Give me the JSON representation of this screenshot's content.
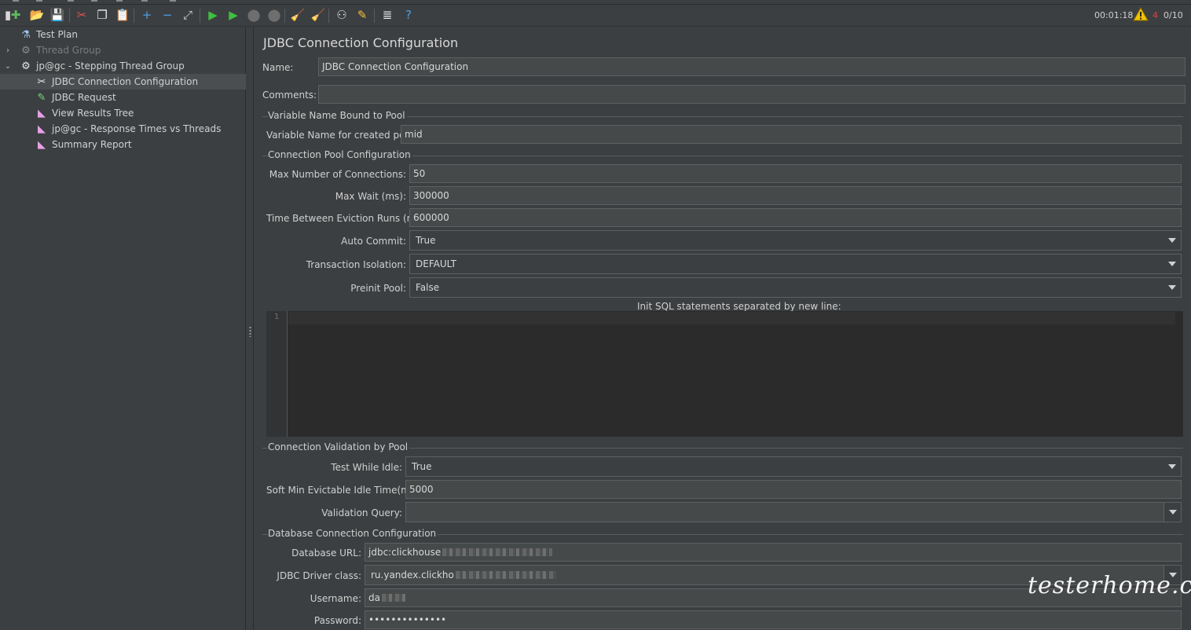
{
  "toolbar": {
    "buttons": [
      {
        "name": "templates-button",
        "glyph": "▮",
        "color": "#d8d8d8"
      },
      {
        "name": "new-button",
        "glyph": "✚",
        "color": "#5fb760"
      },
      {
        "name": "open-button",
        "glyph": "📂",
        "color": "#e2b04a"
      },
      {
        "name": "save-button",
        "glyph": "💾",
        "color": "#c9c9c9"
      },
      {
        "name": "cut-button",
        "glyph": "✂",
        "color": "#d9534f"
      },
      {
        "name": "copy-button",
        "glyph": "❐",
        "color": "#e8e8e8"
      },
      {
        "name": "paste-button",
        "glyph": "📋",
        "color": "#e8e8e8"
      },
      {
        "name": "expand-button",
        "glyph": "+",
        "color": "#4a9fe8"
      },
      {
        "name": "collapse-button",
        "glyph": "−",
        "color": "#4a9fe8"
      },
      {
        "name": "toggle-button",
        "glyph": "⤢",
        "color": "#cfcfcf"
      },
      {
        "name": "start-button",
        "glyph": "▶",
        "color": "#3fbf3f"
      },
      {
        "name": "start-no-pauses-button",
        "glyph": "▶",
        "color": "#3fbf3f"
      },
      {
        "name": "stop-button",
        "glyph": "⬤",
        "color": "#6e6e6e"
      },
      {
        "name": "shutdown-button",
        "glyph": "⬤",
        "color": "#6e6e6e"
      },
      {
        "name": "clear-button",
        "glyph": "🧹",
        "color": "#d9b24a"
      },
      {
        "name": "clear-all-button",
        "glyph": "🧹",
        "color": "#d9b24a"
      },
      {
        "name": "search-button",
        "glyph": "⚇",
        "color": "#d8d8d8"
      },
      {
        "name": "reset-search-button",
        "glyph": "✎",
        "color": "#f0c040"
      },
      {
        "name": "function-helper-button",
        "glyph": "≣",
        "color": "#e8e8e8"
      },
      {
        "name": "help-button",
        "glyph": "?",
        "color": "#4a9fe8"
      }
    ],
    "elapsed": "00:01:18",
    "warning_icon": "warning-icon",
    "error_count": "4",
    "threads": "0/10"
  },
  "tree": {
    "items": [
      {
        "label": "Test Plan",
        "icon": "flask-icon",
        "glyph": "⚗",
        "icon_color": "#9fc4ef",
        "arrow": "",
        "depth": 0,
        "disabled": false,
        "selected": false
      },
      {
        "label": "Thread Group",
        "icon": "gear-icon",
        "glyph": "⚙",
        "icon_color": "#8a8a8a",
        "arrow": "›",
        "depth": 0,
        "disabled": true,
        "selected": false
      },
      {
        "label": "jp@gc - Stepping Thread Group",
        "icon": "gear-icon",
        "glyph": "⚙",
        "icon_color": "#e6e6e6",
        "arrow": "⌄",
        "depth": 0,
        "disabled": false,
        "selected": false
      },
      {
        "label": "JDBC Connection Configuration",
        "icon": "wrench-icon",
        "glyph": "✂",
        "icon_color": "#e6e6e6",
        "arrow": "",
        "depth": 1,
        "disabled": false,
        "selected": true
      },
      {
        "label": "JDBC Request",
        "icon": "pipette-icon",
        "glyph": "✎",
        "icon_color": "#7cd67c",
        "arrow": "",
        "depth": 1,
        "disabled": false,
        "selected": false
      },
      {
        "label": "View Results Tree",
        "icon": "chart-icon",
        "glyph": "◣",
        "icon_color": "#e6a0e6",
        "arrow": "",
        "depth": 1,
        "disabled": false,
        "selected": false
      },
      {
        "label": "jp@gc - Response Times vs Threads",
        "icon": "chart-icon",
        "glyph": "◣",
        "icon_color": "#e6a0e6",
        "arrow": "",
        "depth": 1,
        "disabled": false,
        "selected": false
      },
      {
        "label": "Summary Report",
        "icon": "chart-icon",
        "glyph": "◣",
        "icon_color": "#e6a0e6",
        "arrow": "",
        "depth": 1,
        "disabled": false,
        "selected": false
      }
    ]
  },
  "panel": {
    "title": "JDBC Connection Configuration",
    "name_label": "Name:",
    "name_value": "JDBC Connection Configuration",
    "comments_label": "Comments:",
    "comments_value": "",
    "variable_group": {
      "title": "Variable Name Bound to Pool",
      "pool_label": "Variable Name for created pool:",
      "pool_value": "mid"
    },
    "pool_group": {
      "title": "Connection Pool Configuration",
      "max_connections_label": "Max Number of Connections:",
      "max_connections_value": "50",
      "max_wait_label": "Max Wait (ms):",
      "max_wait_value": "300000",
      "eviction_label": "Time Between Eviction Runs (ms):",
      "eviction_value": "600000",
      "auto_commit_label": "Auto Commit:",
      "auto_commit_value": "True",
      "isolation_label": "Transaction Isolation:",
      "isolation_value": "DEFAULT",
      "preinit_label": "Preinit Pool:",
      "preinit_value": "False",
      "init_sql_label": "Init SQL statements separated by new line:",
      "init_sql_line_number": "1"
    },
    "validation_group": {
      "title": "Connection Validation by Pool",
      "test_idle_label": "Test While Idle:",
      "test_idle_value": "True",
      "soft_min_label": "Soft Min Evictable Idle Time(ms):",
      "soft_min_value": "5000",
      "query_label": "Validation Query:",
      "query_value": ""
    },
    "db_group": {
      "title": "Database Connection Configuration",
      "url_label": "Database URL:",
      "url_value": "jdbc:clickhouse",
      "driver_label": "JDBC Driver class:",
      "driver_value": "ru.yandex.clickho",
      "username_label": "Username:",
      "username_value": "da",
      "password_label": "Password:",
      "password_value": "••••••••••••••"
    }
  },
  "watermark": "testerhome.com"
}
